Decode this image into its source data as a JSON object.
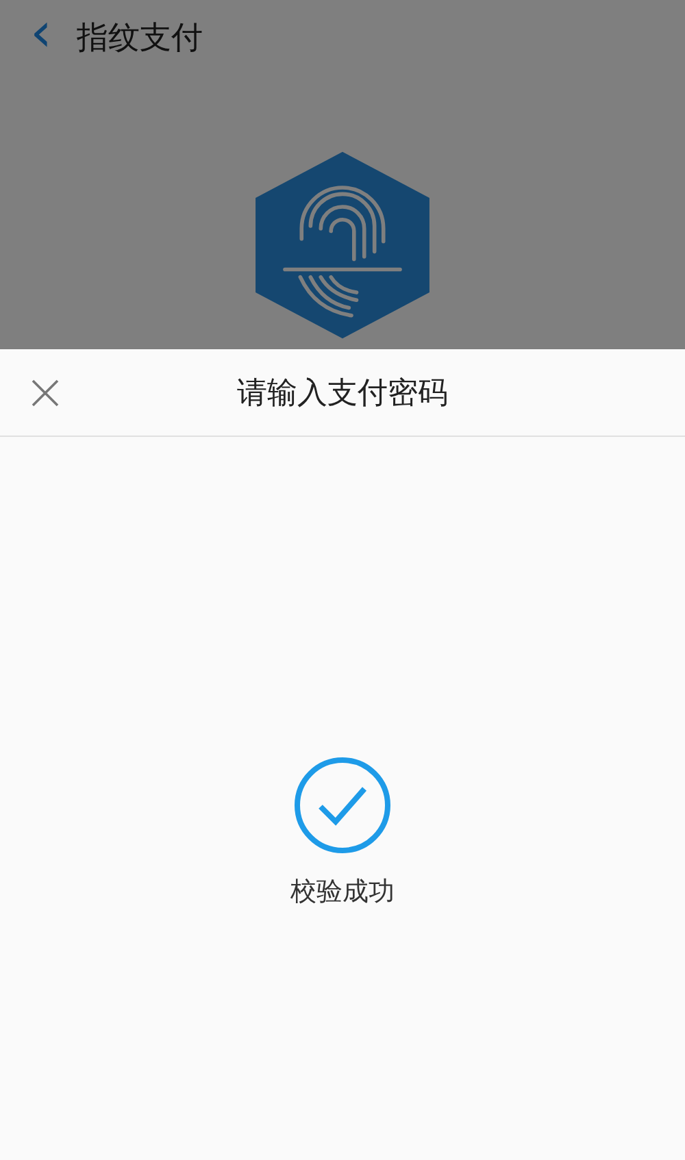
{
  "header": {
    "back_glyph": "‹",
    "title": "指纹支付"
  },
  "sheet": {
    "title": "请输入支付密码",
    "status": {
      "kind": "success",
      "message": "校验成功"
    }
  }
}
